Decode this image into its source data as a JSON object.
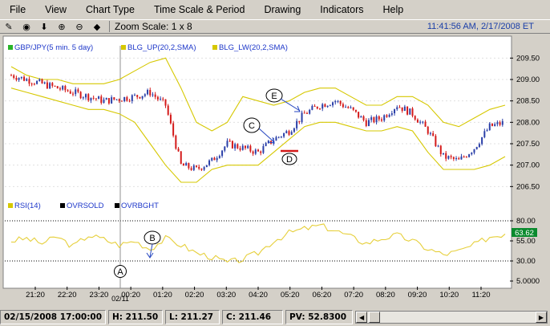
{
  "menu": [
    "File",
    "View",
    "Chart Type",
    "Time Scale & Period",
    "Drawing",
    "Indicators",
    "Help"
  ],
  "toolbar": {
    "icons": [
      "pencil-icon",
      "crosshair-icon",
      "arrow-down-icon",
      "zoom-in-icon",
      "zoom-out-icon",
      "gem-icon"
    ],
    "zoom_label": "Zoom Scale: 1 x 8"
  },
  "clock": "11:41:56 AM, 2/17/2008 ET",
  "legend_price": {
    "symbol": "GBP/JPY(5 min.  5 day)",
    "upper": "BLG_UP(20,2,SMA)",
    "lower": "BLG_LW(20,2,SMA)"
  },
  "legend_rsi": {
    "rsi": "RSI(14)",
    "oversold": "OVRSOLD",
    "overbought": "OVRBGHT"
  },
  "rsi_value_badge": "63.62",
  "colors": {
    "price_label": "#1c36c9",
    "band": "#d6c800",
    "candle_up": "#2a3fa8",
    "candle_down": "#d41a1a",
    "rsi_line": "#e6cf3a",
    "annotation": "#2445c0",
    "badge_bg": "#0a8a2e"
  },
  "annotations": [
    "A",
    "B",
    "C",
    "D",
    "E"
  ],
  "date_marker": "02/11",
  "status": {
    "datetime": "02/15/2008 17:00:00",
    "high": "H: 211.50",
    "low": "L: 211.27",
    "close": "C: 211.46",
    "pv": "PV: 52.8300"
  },
  "chart_data": [
    {
      "type": "candlestick",
      "series": [
        {
          "name": "GBP/JPY(5 min.  5 day)",
          "values": [
            209.1,
            209.0,
            208.9,
            208.8,
            208.7,
            208.6,
            208.5,
            208.55,
            208.6,
            208.7,
            208.4,
            207.0,
            206.9,
            207.1,
            207.5,
            207.4,
            207.3,
            207.6,
            207.8,
            208.2,
            208.4,
            208.5,
            208.3,
            208.0,
            208.1,
            208.4,
            208.2,
            207.8,
            207.2,
            207.1,
            207.4,
            207.9,
            208.0
          ]
        },
        {
          "name": "BLG_UP(20,2,SMA)",
          "values": [
            209.3,
            209.1,
            209.0,
            209.0,
            208.9,
            208.9,
            208.9,
            209.0,
            209.2,
            209.4,
            209.5,
            208.8,
            208.0,
            207.8,
            208.0,
            208.6,
            208.5,
            208.4,
            208.5,
            208.7,
            208.8,
            208.8,
            208.6,
            208.4,
            208.4,
            208.6,
            208.6,
            208.4,
            208.0,
            207.9,
            208.1,
            208.3,
            208.4
          ]
        },
        {
          "name": "BLG_LW(20,2,SMA)",
          "values": [
            208.8,
            208.7,
            208.6,
            208.5,
            208.4,
            208.3,
            208.3,
            208.2,
            208.0,
            207.5,
            207.0,
            206.6,
            206.6,
            206.9,
            207.0,
            207.0,
            207.0,
            207.3,
            207.6,
            207.9,
            208.0,
            208.0,
            207.9,
            207.8,
            207.8,
            207.9,
            207.8,
            207.3,
            206.9,
            206.9,
            206.9,
            207.0,
            207.2
          ]
        }
      ],
      "x": [
        "21:20",
        "22:20",
        "23:20",
        "00:20",
        "01:20",
        "02:20",
        "03:20",
        "04:20",
        "05:20",
        "06:20",
        "07:20",
        "08:20",
        "09:20",
        "10:20",
        "11:20"
      ],
      "yticks": [
        "209.50",
        "209.00",
        "208.50",
        "208.00",
        "207.50",
        "207.00",
        "206.50"
      ],
      "ylim": [
        206.3,
        209.75
      ]
    },
    {
      "type": "line",
      "series": [
        {
          "name": "RSI(14)",
          "values": [
            55,
            58,
            52,
            60,
            48,
            62,
            57,
            50,
            55,
            45,
            58,
            50,
            40,
            35,
            28,
            32,
            40,
            55,
            65,
            70,
            74,
            68,
            60,
            52,
            58,
            62,
            55,
            45,
            38,
            42,
            50,
            60,
            63.62
          ]
        }
      ],
      "yticks": [
        "80.00",
        "55.00",
        "30.00",
        "5.0000"
      ],
      "ylim": [
        0,
        90
      ],
      "levels": [
        30,
        80
      ]
    }
  ]
}
